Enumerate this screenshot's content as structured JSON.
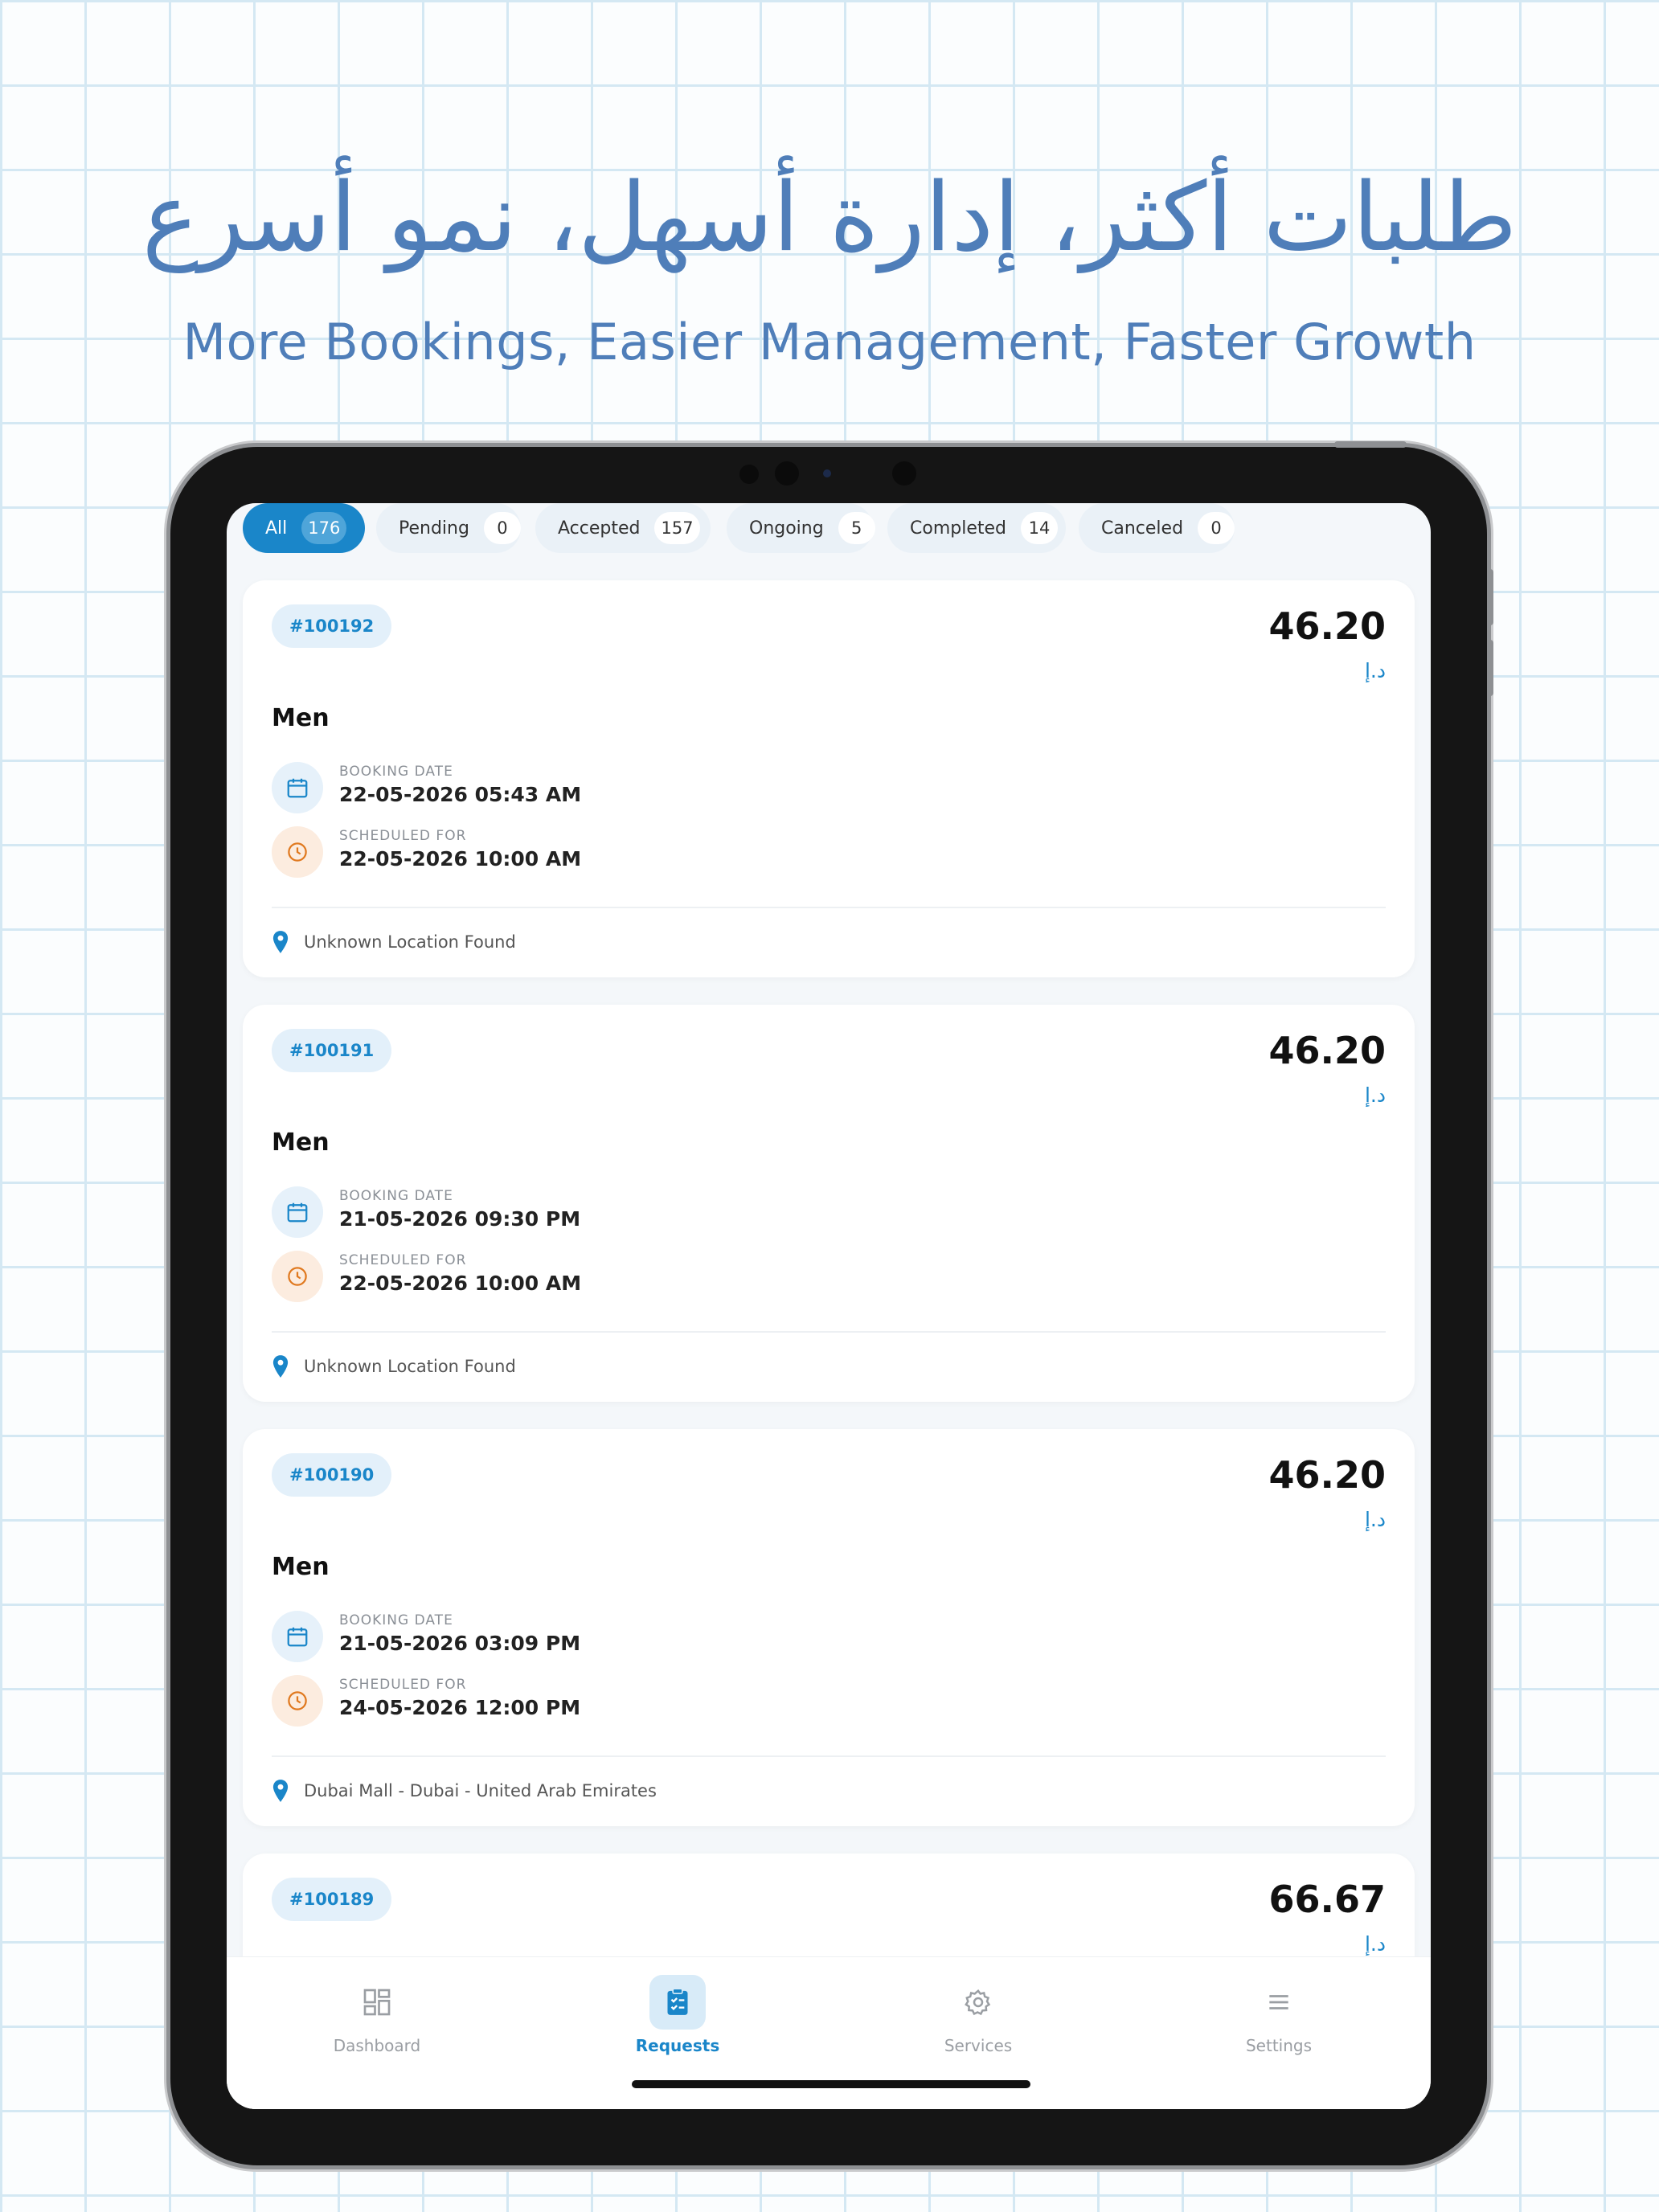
{
  "marketing": {
    "headline_ar": "طلبات أكثر، إدارة أسهل، نمو أسرع",
    "headline_en": "More Bookings, Easier Management, Faster Growth"
  },
  "tabs": [
    {
      "label": "All",
      "count": "176",
      "active": true
    },
    {
      "label": "Pending",
      "count": "0",
      "active": false
    },
    {
      "label": "Accepted",
      "count": "157",
      "active": false
    },
    {
      "label": "Ongoing",
      "count": "5",
      "active": false
    },
    {
      "label": "Completed",
      "count": "14",
      "active": false
    },
    {
      "label": "Canceled",
      "count": "0",
      "active": false
    }
  ],
  "labels": {
    "booking_date": "BOOKING DATE",
    "scheduled_for": "SCHEDULED FOR"
  },
  "bookings": [
    {
      "id": "#100192",
      "price": "46.20",
      "currency": "د.إ",
      "service": "Men",
      "booking_date": "22-05-2026  05:43 AM",
      "scheduled_for": "22-05-2026  10:00 AM",
      "location": "Unknown Location Found"
    },
    {
      "id": "#100191",
      "price": "46.20",
      "currency": "د.إ",
      "service": "Men",
      "booking_date": "21-05-2026  09:30 PM",
      "scheduled_for": "22-05-2026  10:00 AM",
      "location": "Unknown Location Found"
    },
    {
      "id": "#100190",
      "price": "46.20",
      "currency": "د.إ",
      "service": "Men",
      "booking_date": "21-05-2026  03:09 PM",
      "scheduled_for": "24-05-2026  12:00 PM",
      "location": "Dubai Mall - Dubai - United Arab Emirates"
    },
    {
      "id": "#100189",
      "price": "66.67",
      "currency": "د.إ"
    }
  ],
  "nav": [
    {
      "label": "Dashboard",
      "icon": "dashboard-icon",
      "active": false
    },
    {
      "label": "Requests",
      "icon": "clipboard-check-icon",
      "active": true
    },
    {
      "label": "Services",
      "icon": "gear-icon",
      "active": false
    },
    {
      "label": "Settings",
      "icon": "menu-icon",
      "active": false
    }
  ],
  "colors": {
    "primary": "#1a86c9",
    "headline": "#4f7eb9",
    "accent_orange": "#e0791f"
  }
}
